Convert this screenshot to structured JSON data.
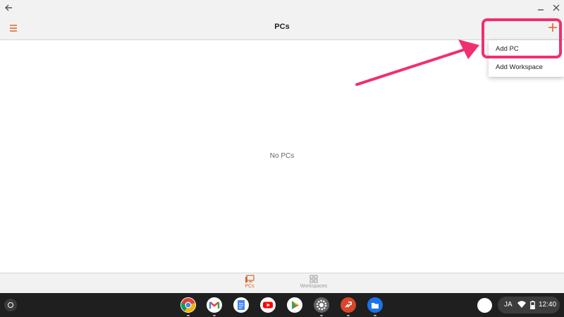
{
  "window": {
    "back_icon": "arrow-left-icon",
    "minimize_icon": "minimize-icon",
    "close_icon": "close-icon"
  },
  "toolbar": {
    "title": "PCs",
    "menu_icon": "hamburger-menu-icon",
    "add_icon": "plus-icon"
  },
  "main": {
    "empty_text": "No PCs"
  },
  "dropdown": {
    "items": [
      {
        "label": "Add PC"
      },
      {
        "label": "Add Workspace"
      }
    ]
  },
  "bottom_nav": {
    "tabs": [
      {
        "label": "PCs",
        "icon": "monitor-icon",
        "selected": true
      },
      {
        "label": "Workspaces",
        "icon": "workspaces-grid-icon",
        "selected": false
      }
    ]
  },
  "shelf": {
    "apps": [
      "chrome-icon",
      "gmail-icon",
      "docs-icon",
      "youtube-icon",
      "play-store-icon",
      "settings-icon",
      "remote-desktop-icon",
      "files-icon"
    ],
    "ime": "JA",
    "time": "12:40"
  },
  "colors": {
    "accent": "#d9662a",
    "highlight": "#f0306e",
    "shelf": "#1f1f1f",
    "toolbar": "#f2f2f2"
  }
}
